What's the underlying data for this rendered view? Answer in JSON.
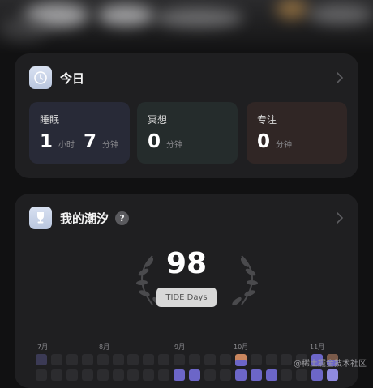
{
  "today": {
    "title": "今日",
    "stats": [
      {
        "label": "睡眠",
        "hours": "1",
        "hours_unit": "小时",
        "minutes": "7",
        "minutes_unit": "分钟"
      },
      {
        "label": "冥想",
        "minutes": "0",
        "minutes_unit": "分钟"
      },
      {
        "label": "专注",
        "minutes": "0",
        "minutes_unit": "分钟"
      }
    ]
  },
  "tide": {
    "title": "我的潮汐",
    "help": "?",
    "days": "98",
    "badge": "TIDE Days",
    "months": [
      "7月",
      "8月",
      "9月",
      "10月",
      "11月"
    ]
  },
  "watermark": "@稀土掘金技术社区",
  "colors": {
    "card": "#1f1f21",
    "sleep_tile": "#282a37",
    "meditate_tile": "#252c2c",
    "focus_tile": "#302625",
    "heat_purple": "#6c66c8",
    "heat_orange": "#c9865e"
  }
}
